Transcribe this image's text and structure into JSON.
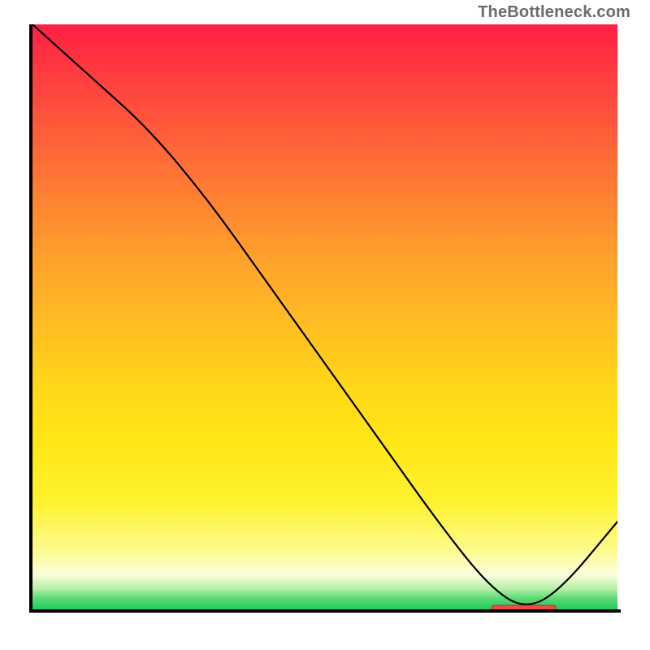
{
  "attribution": "TheBottleneck.com",
  "chart_data": {
    "type": "line",
    "title": "",
    "xlabel": "",
    "ylabel": "",
    "xlim": [
      0,
      100
    ],
    "ylim": [
      0,
      100
    ],
    "x": [
      0,
      10,
      20,
      30,
      40,
      50,
      60,
      70,
      78,
      84,
      90,
      100
    ],
    "values": [
      100,
      91,
      82,
      70,
      56,
      42,
      28,
      14,
      4,
      0,
      3,
      15
    ],
    "optimum_x": 84,
    "optimum_y": 0,
    "background_gradient": {
      "top": "#ff1f45",
      "mid": "#ffd719",
      "bottom": "#1fc95e"
    }
  }
}
